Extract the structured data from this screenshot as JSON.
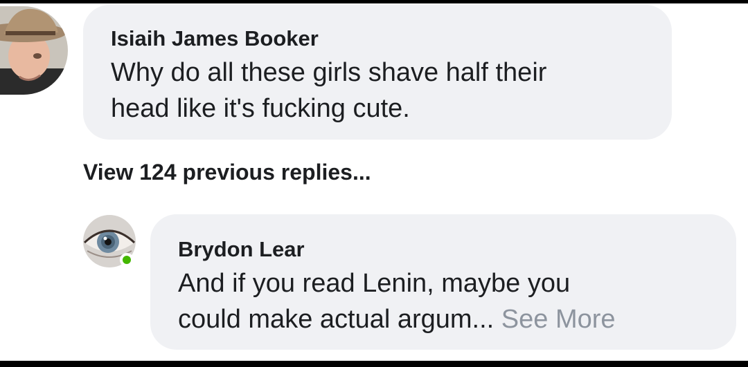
{
  "comment1": {
    "author": "Isiaih James Booker",
    "lines": "Why do all these girls shave half their\nhead like it's fucking cute."
  },
  "view_replies": "View 124 previous replies...",
  "comment2": {
    "author": "Brydon Lear",
    "line1": "And if you read Lenin, maybe you",
    "line2_prefix": "could make actual argum...",
    "see_more": "See More",
    "online": true
  },
  "colors": {
    "bubble": "#f0f1f4",
    "text": "#1c1e21",
    "muted": "#8d949e",
    "online": "#44b700"
  }
}
